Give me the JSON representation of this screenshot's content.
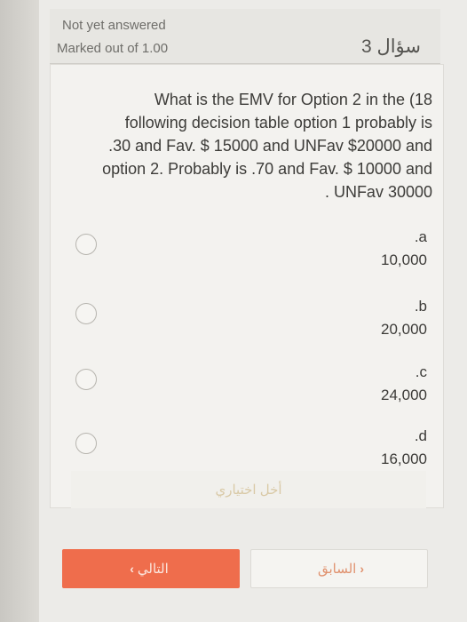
{
  "info": {
    "status": "Not yet answered",
    "mark": "Marked out of 1.00",
    "question_number": "سؤال 3"
  },
  "question": {
    "lines": [
      "What is the EMV for Option 2 in the (18",
      "following decision table option 1 probably is",
      ".30 and Fav. $ 15000 and UNFav $20000 and",
      "option 2. Probably is .70 and Fav. $ 10000 and",
      ". UNFav 30000"
    ]
  },
  "answers": [
    {
      "letter": ".a",
      "value": "10,000"
    },
    {
      "letter": ".b",
      "value": "20,000"
    },
    {
      "letter": ".c",
      "value": "24,000"
    },
    {
      "letter": ".d",
      "value": "16,000"
    }
  ],
  "clear_choice": "أخل اختياري",
  "nav": {
    "next": "التالي",
    "prev": "السابق"
  },
  "colors": {
    "accent": "#ef6d4c",
    "background": "#ecebe8"
  }
}
